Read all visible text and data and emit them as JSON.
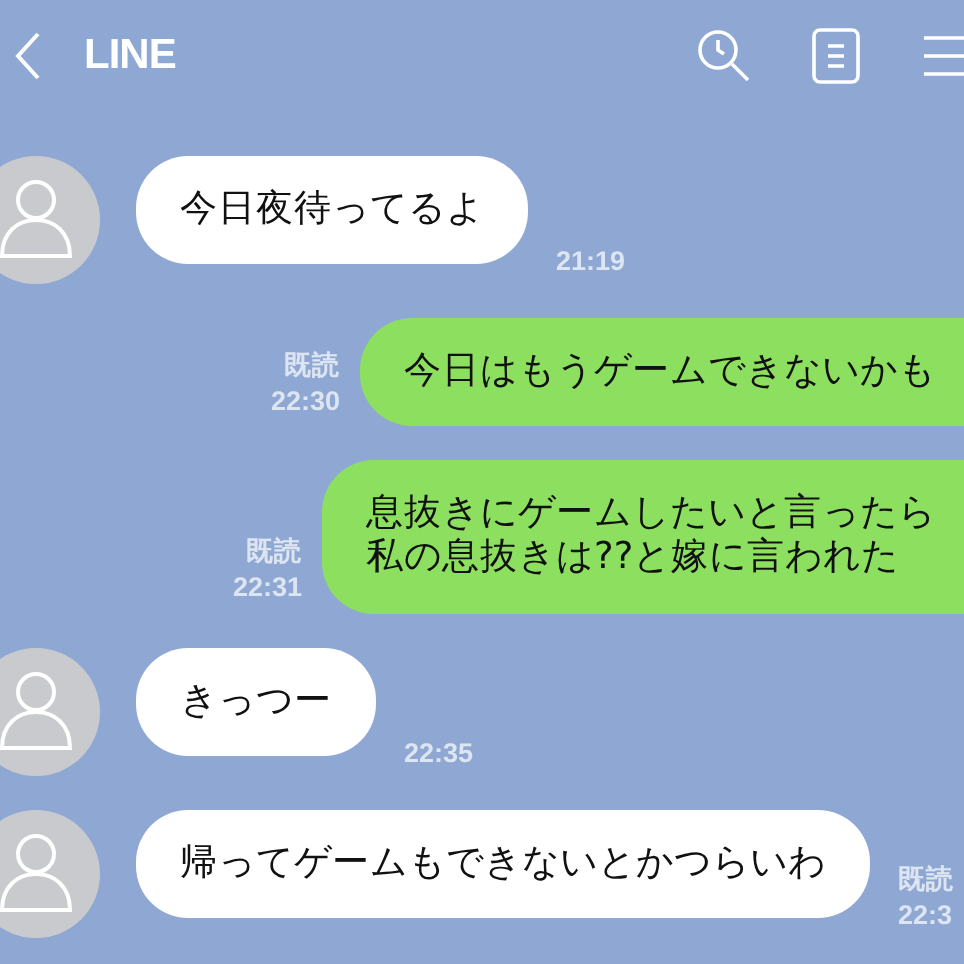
{
  "header": {
    "title": "LINE"
  },
  "messages": [
    {
      "kind": "received",
      "lines": [
        "今日夜待ってるよ"
      ],
      "time": "21:19"
    },
    {
      "kind": "sent",
      "lines": [
        "今日はもうゲームできないかも"
      ],
      "read_label": "既読",
      "time": "22:30"
    },
    {
      "kind": "sent",
      "lines": [
        "息抜きにゲームしたいと言ったら",
        "私の息抜きは??と嫁に言われた"
      ],
      "read_label": "既読",
      "time": "22:31"
    },
    {
      "kind": "received",
      "lines": [
        "きっつー"
      ],
      "time": "22:35"
    },
    {
      "kind": "received",
      "lines": [
        "帰ってゲームもできないとかつらいわ"
      ],
      "read_label": "既読",
      "time": "22:3"
    }
  ]
}
